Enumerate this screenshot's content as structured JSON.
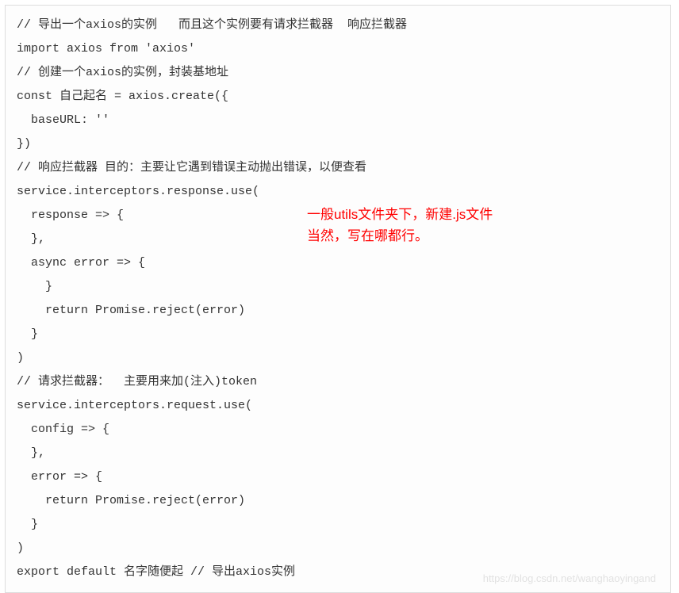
{
  "code": {
    "lines": [
      "// 导出一个axios的实例   而且这个实例要有请求拦截器  响应拦截器",
      "import axios from 'axios'",
      "// 创建一个axios的实例，封装基地址",
      "const 自己起名 = axios.create({",
      "  baseURL: ''",
      "})",
      "// 响应拦截器 目的：主要让它遇到错误主动抛出错误，以便查看",
      "service.interceptors.response.use(",
      "  response => {",
      "  },",
      "  async error => {",
      "    }",
      "    return Promise.reject(error)",
      "  }",
      ")",
      "// 请求拦截器：  主要用来加(注入)token",
      "service.interceptors.request.use(",
      "  config => {",
      "  },",
      "  error => {",
      "    return Promise.reject(error)",
      "  }",
      ")",
      "export default 名字随便起 // 导出axios实例"
    ]
  },
  "annotation": {
    "line1": "一般utils文件夹下，新建.js文件",
    "line2": "当然，写在哪都行。"
  },
  "watermark": "https://blog.csdn.net/wanghaoyingand"
}
